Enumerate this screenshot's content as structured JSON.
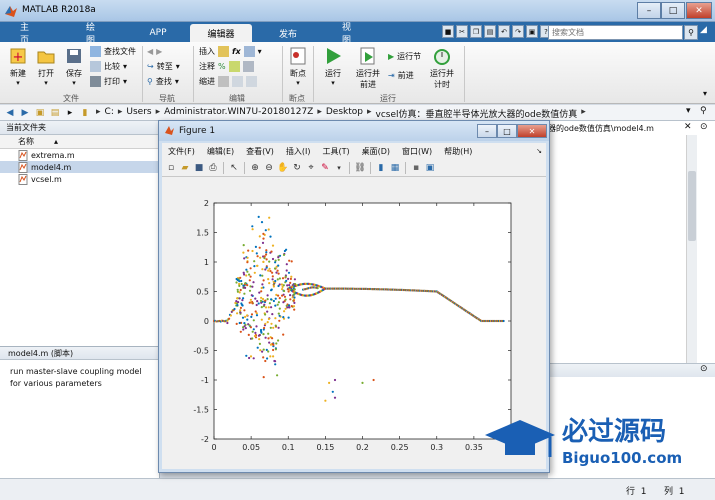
{
  "window": {
    "title": "MATLAB R2018a"
  },
  "tabs": [
    "主页",
    "绘图",
    "APP",
    "编辑器",
    "发布",
    "视图"
  ],
  "active_tab": "编辑器",
  "search": {
    "placeholder": "搜索文档"
  },
  "ribbon": {
    "file_group": {
      "label": "文件",
      "new": "新建",
      "open": "打开",
      "save": "保存",
      "find_files": "查找文件",
      "compare": "比较",
      "print": "打印"
    },
    "nav_group": {
      "label": "导航",
      "goto": "转至",
      "find": "查找"
    },
    "edit_group": {
      "label": "编辑",
      "insert": "插入",
      "comment": "注释",
      "indent": "缩进"
    },
    "breakpoint_group": {
      "label": "断点",
      "breakpoints": "断点"
    },
    "run_group": {
      "label": "运行",
      "run": "运行",
      "run_advance": "运行并\n前进",
      "run_section": "运行节",
      "advance": "前进",
      "run_time": "运行并\n计时"
    }
  },
  "breadcrumbs": [
    "C:",
    "Users",
    "Administrator.WIN7U-20180127Z",
    "Desktop",
    "vcsel仿真：垂直腔半导体光放大器的ode数值仿真"
  ],
  "current_folder": {
    "title": "当前文件夹",
    "name_col": "名称",
    "files": [
      "extrema.m",
      "model4.m",
      "vcsel.m"
    ],
    "selected": "model4.m"
  },
  "details": {
    "header": "model4.m  (脚本)",
    "text": "run master-slave coupling model for various parameters"
  },
  "editor": {
    "title_fragment": "器的ode数值仿真\\model4.m"
  },
  "status": {
    "row": "行",
    "row_val": "1",
    "col": "列",
    "col_val": "1"
  },
  "figure": {
    "title": "Figure 1",
    "menu": [
      "文件(F)",
      "编辑(E)",
      "查看(V)",
      "插入(I)",
      "工具(T)",
      "桌面(D)",
      "窗口(W)",
      "帮助(H)"
    ]
  },
  "watermark": {
    "text1": "必过源码",
    "text2": "Biguo100.com"
  },
  "chart_data": {
    "type": "scatter",
    "xlim": [
      0,
      0.4
    ],
    "ylim": [
      -2,
      2
    ],
    "xticks": [
      0,
      0.05,
      0.1,
      0.15,
      0.2,
      0.25,
      0.3,
      0.35
    ],
    "yticks": [
      -2,
      -1.5,
      -1,
      -0.5,
      0,
      0.5,
      1,
      1.5,
      2
    ],
    "grid": false,
    "colors": [
      "#d95319",
      "#0072bd",
      "#edb120",
      "#7e2f8e",
      "#77ac30"
    ]
  }
}
